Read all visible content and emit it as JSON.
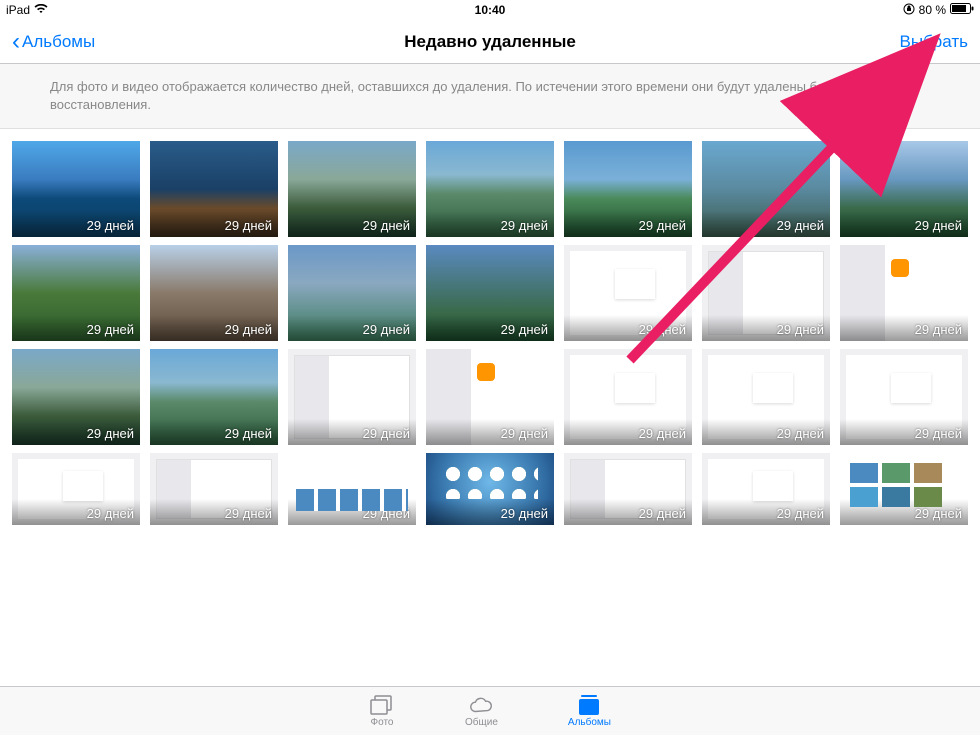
{
  "status_bar": {
    "device": "iPad",
    "time": "10:40",
    "battery_percent": "80 %"
  },
  "nav": {
    "back_label": "Альбомы",
    "title": "Недавно удаленные",
    "select_label": "Выбрать"
  },
  "info_banner": "Для фото и видео отображается количество дней, оставшихся до удаления. По истечении этого времени они будут удалены без возможности восстановления.",
  "days_label": "29 дней",
  "thumbs": [
    {
      "kind": "t-nature1"
    },
    {
      "kind": "t-nature2"
    },
    {
      "kind": "t-nature3"
    },
    {
      "kind": "t-nature4"
    },
    {
      "kind": "t-nature5"
    },
    {
      "kind": "t-nature6"
    },
    {
      "kind": "t-nature7"
    },
    {
      "kind": "t-nature8"
    },
    {
      "kind": "t-nature9"
    },
    {
      "kind": "t-nature10"
    },
    {
      "kind": "t-nature11"
    },
    {
      "kind": "t-shot2"
    },
    {
      "kind": "t-shot"
    },
    {
      "kind": "t-shot3"
    },
    {
      "kind": "t-nature3"
    },
    {
      "kind": "t-nature4"
    },
    {
      "kind": "t-shot"
    },
    {
      "kind": "t-shot3"
    },
    {
      "kind": "t-shot2"
    },
    {
      "kind": "t-shot2"
    },
    {
      "kind": "t-shot2"
    },
    {
      "kind": "t-shot2"
    },
    {
      "kind": "t-shot"
    },
    {
      "kind": "t-thumbs"
    },
    {
      "kind": "t-home"
    },
    {
      "kind": "t-shot"
    },
    {
      "kind": "t-shot2"
    },
    {
      "kind": "t-gallery"
    }
  ],
  "tabs": {
    "photos": "Фото",
    "shared": "Общие",
    "albums": "Альбомы"
  }
}
